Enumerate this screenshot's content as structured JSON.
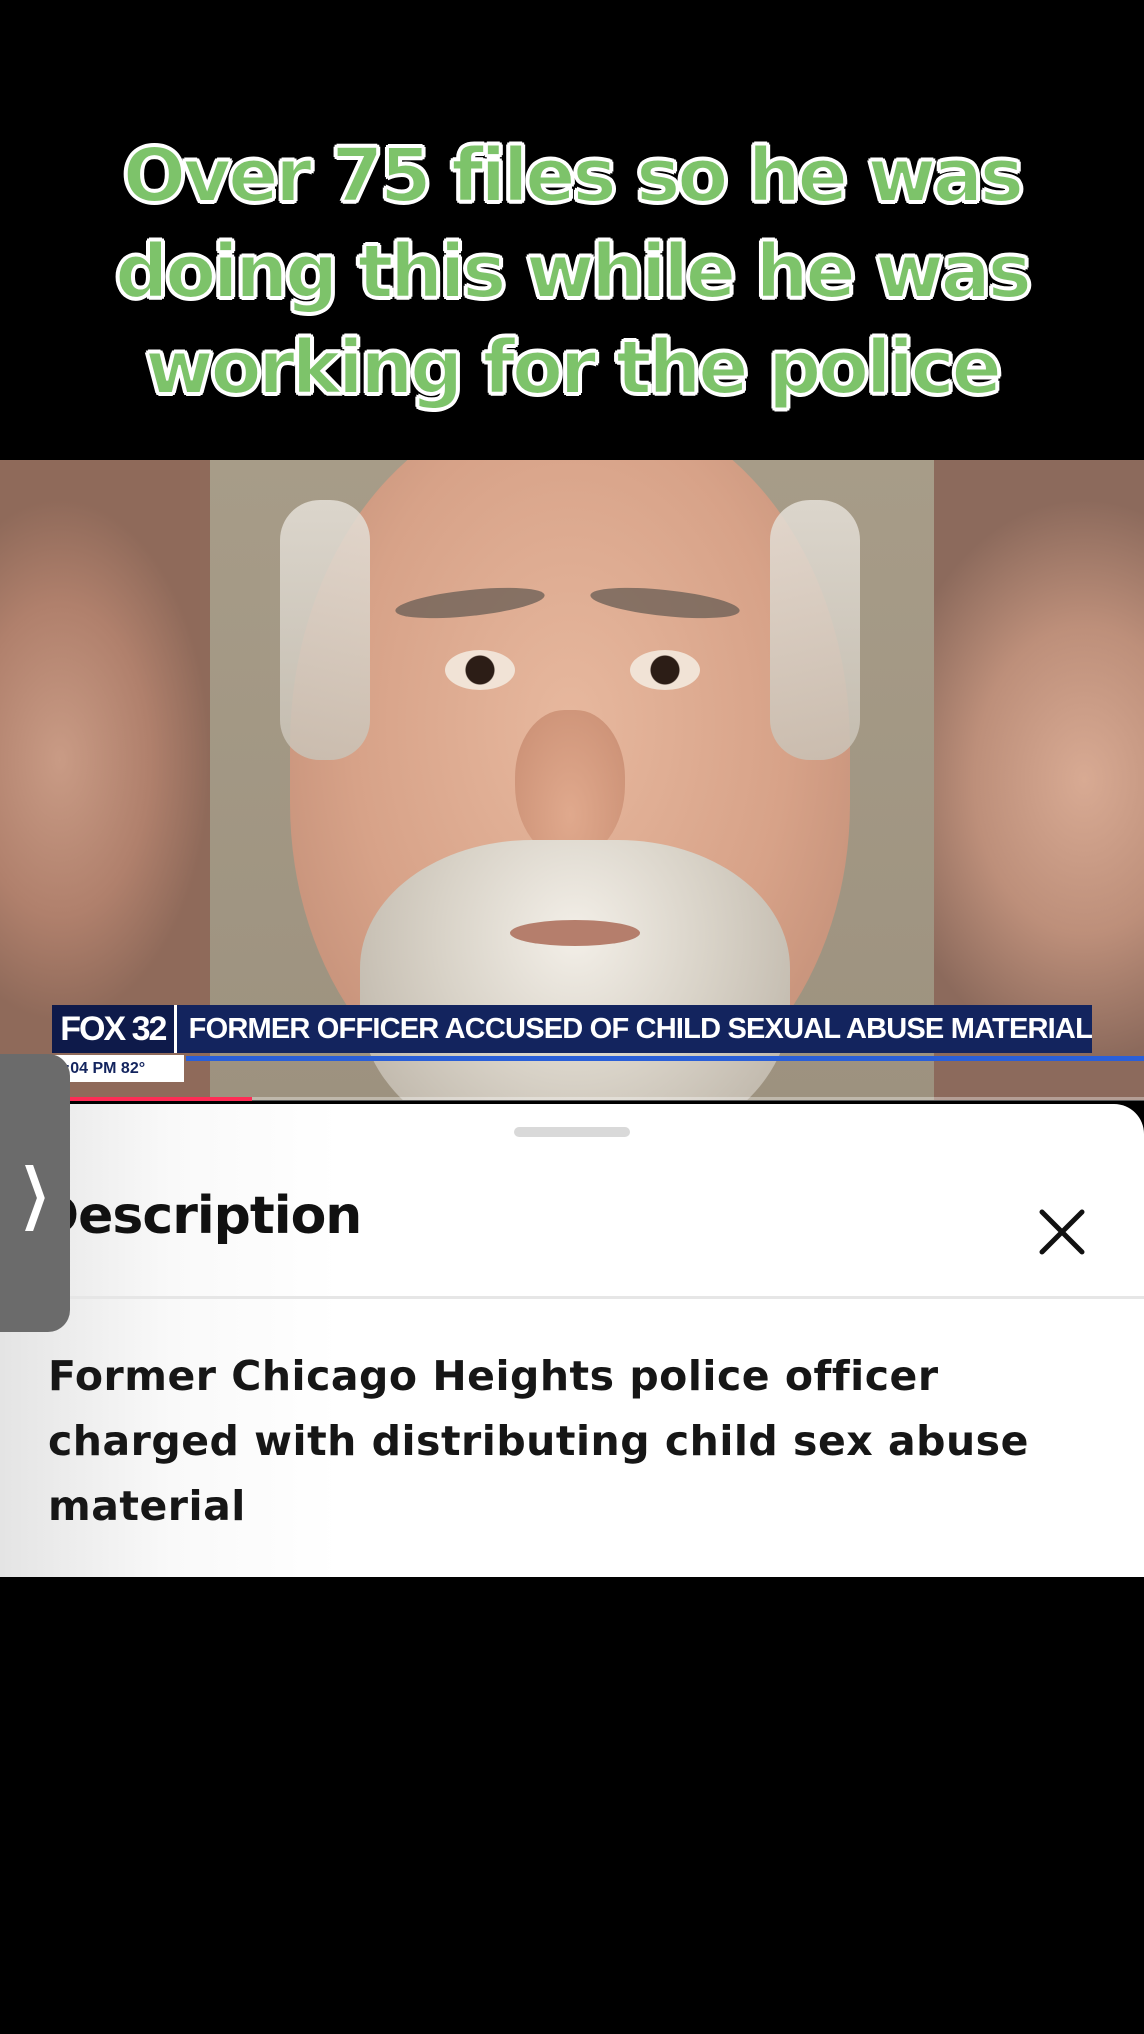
{
  "caption": {
    "text": "Over 75 files so he was\ndoing this while he was\nworking for the police",
    "color": "#7dc36a"
  },
  "news_overlay": {
    "channel_logo": "FOX 32",
    "headline": "FORMER OFFICER ACCUSED OF CHILD SEXUAL ABUSE MATERIAL",
    "time_temp": "5:04 PM   82°"
  },
  "progress": {
    "fraction": 0.22,
    "color": "#fe2c55"
  },
  "description_sheet": {
    "title": "Description",
    "close_icon": "close-icon",
    "body": "Former Chicago Heights police officer charged with distributing child sex abuse material"
  },
  "side_tab": {
    "icon": "chevron-right-icon",
    "glyph": "❯"
  }
}
